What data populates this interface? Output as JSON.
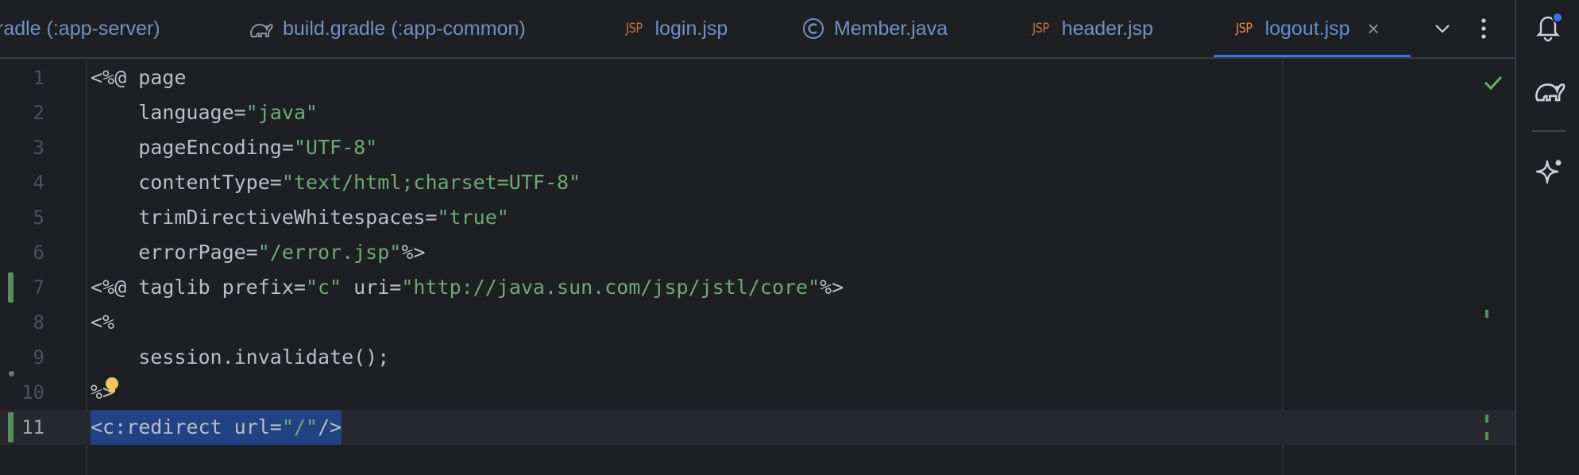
{
  "tabs": [
    {
      "label": "radle (:app-server)",
      "icon": "none",
      "active": false
    },
    {
      "label": "build.gradle (:app-common)",
      "icon": "gradle-elephant-icon",
      "active": false
    },
    {
      "label": "login.jsp",
      "icon": "JSP",
      "active": false
    },
    {
      "label": "Member.java",
      "icon": "class-c-icon",
      "active": false
    },
    {
      "label": "header.jsp",
      "icon": "JSP",
      "active": false
    },
    {
      "label": "logout.jsp",
      "icon": "JSP",
      "active": true
    }
  ],
  "jsp_icon_text": "JSP",
  "close_glyph": "×",
  "colors": {
    "background": "#1e1f22",
    "tab_text": "#6b93c7",
    "active_underline": "#3574f0",
    "jsp_icon": "#c2763b",
    "string": "#6aab73",
    "code_text": "#bcbec4",
    "selection": "#214283",
    "change_marker": "#549159"
  },
  "editor": {
    "lines": [
      {
        "num": "1",
        "code": "<%@ page"
      },
      {
        "num": "2",
        "code": "    language=\"java\""
      },
      {
        "num": "3",
        "code": "    pageEncoding=\"UTF-8\""
      },
      {
        "num": "4",
        "code": "    contentType=\"text/html;charset=UTF-8\""
      },
      {
        "num": "5",
        "code": "    trimDirectiveWhitespaces=\"true\""
      },
      {
        "num": "6",
        "code": "    errorPage=\"/error.jsp\"%>"
      },
      {
        "num": "7",
        "code": "<%@ taglib prefix=\"c\" uri=\"http://java.sun.com/jsp/jstl/core\"%>",
        "changed": true
      },
      {
        "num": "8",
        "code": "<%"
      },
      {
        "num": "9",
        "code": "    session.invalidate();"
      },
      {
        "num": "10",
        "code": "%>"
      },
      {
        "num": "11",
        "code": "<c:redirect url=\"/\"/>",
        "changed": true,
        "current": true,
        "selected": true
      }
    ],
    "inspection_status": "check-icon"
  },
  "toolstrip": [
    "notifications-icon",
    "gradle-icon",
    "ai-assistant-icon"
  ]
}
